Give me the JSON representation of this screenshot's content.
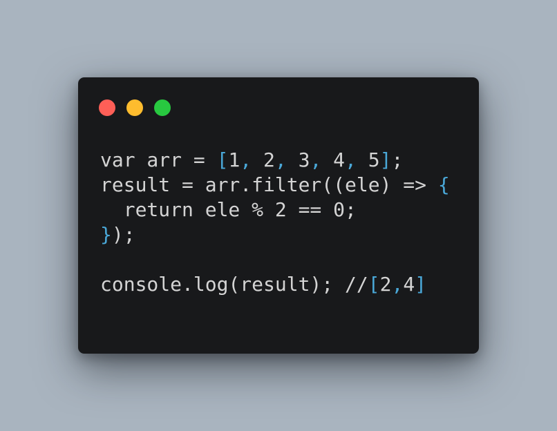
{
  "colors": {
    "background": "#a9b4bf",
    "window": "#18191b",
    "text": "#d4d4d4",
    "punctuation": "#4aa8d8",
    "close": "#fe5f57",
    "minimize": "#febc2e",
    "maximize": "#28c840"
  },
  "window_controls": [
    {
      "name": "close-button",
      "color": "#fe5f57"
    },
    {
      "name": "minimize-button",
      "color": "#febc2e"
    },
    {
      "name": "maximize-button",
      "color": "#28c840"
    }
  ],
  "code": {
    "lines": [
      {
        "tokens": [
          {
            "text": "var arr = ",
            "kind": "plain"
          },
          {
            "text": "[",
            "kind": "punct"
          },
          {
            "text": "1",
            "kind": "plain"
          },
          {
            "text": ",",
            "kind": "punct"
          },
          {
            "text": " 2",
            "kind": "plain"
          },
          {
            "text": ",",
            "kind": "punct"
          },
          {
            "text": " 3",
            "kind": "plain"
          },
          {
            "text": ",",
            "kind": "punct"
          },
          {
            "text": " 4",
            "kind": "plain"
          },
          {
            "text": ",",
            "kind": "punct"
          },
          {
            "text": " 5",
            "kind": "plain"
          },
          {
            "text": "]",
            "kind": "punct"
          },
          {
            "text": ";",
            "kind": "plain"
          }
        ]
      },
      {
        "tokens": [
          {
            "text": "result = arr.filter((ele) => ",
            "kind": "plain"
          },
          {
            "text": "{",
            "kind": "punct"
          }
        ]
      },
      {
        "tokens": [
          {
            "text": "  return ele % 2 == 0;",
            "kind": "plain"
          }
        ]
      },
      {
        "tokens": [
          {
            "text": "}",
            "kind": "punct"
          },
          {
            "text": ");",
            "kind": "plain"
          }
        ]
      },
      {
        "tokens": []
      },
      {
        "tokens": [
          {
            "text": "console.log(result); //",
            "kind": "plain"
          },
          {
            "text": "[",
            "kind": "punct"
          },
          {
            "text": "2",
            "kind": "plain"
          },
          {
            "text": ",",
            "kind": "punct"
          },
          {
            "text": "4",
            "kind": "plain"
          },
          {
            "text": "]",
            "kind": "punct"
          }
        ]
      }
    ]
  }
}
